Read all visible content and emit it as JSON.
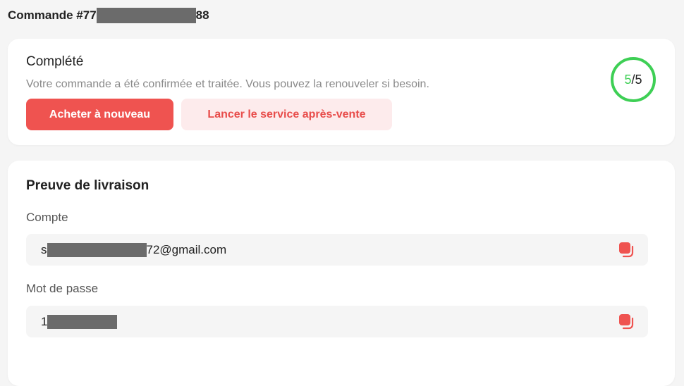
{
  "order": {
    "prefix": "Commande #77",
    "suffix": "88"
  },
  "status": {
    "title": "Complété",
    "description": "Votre commande a été confirmée et traitée. Vous pouvez la renouveler si besoin.",
    "buy_again_label": "Acheter à nouveau",
    "after_sales_label": "Lancer le service après-vente",
    "progress_done": "5",
    "progress_sep": "/",
    "progress_total": "5",
    "progress_fraction": 1.0
  },
  "proof": {
    "title": "Preuve de livraison",
    "account_label": "Compte",
    "account_prefix": "s",
    "account_suffix": "72@gmail.com",
    "password_label": "Mot de passe",
    "password_prefix": "1"
  },
  "colors": {
    "accent": "#ef5350",
    "accent_light": "#fdebec",
    "success": "#3ecf55"
  },
  "icons": {
    "copy": "copy-icon"
  }
}
